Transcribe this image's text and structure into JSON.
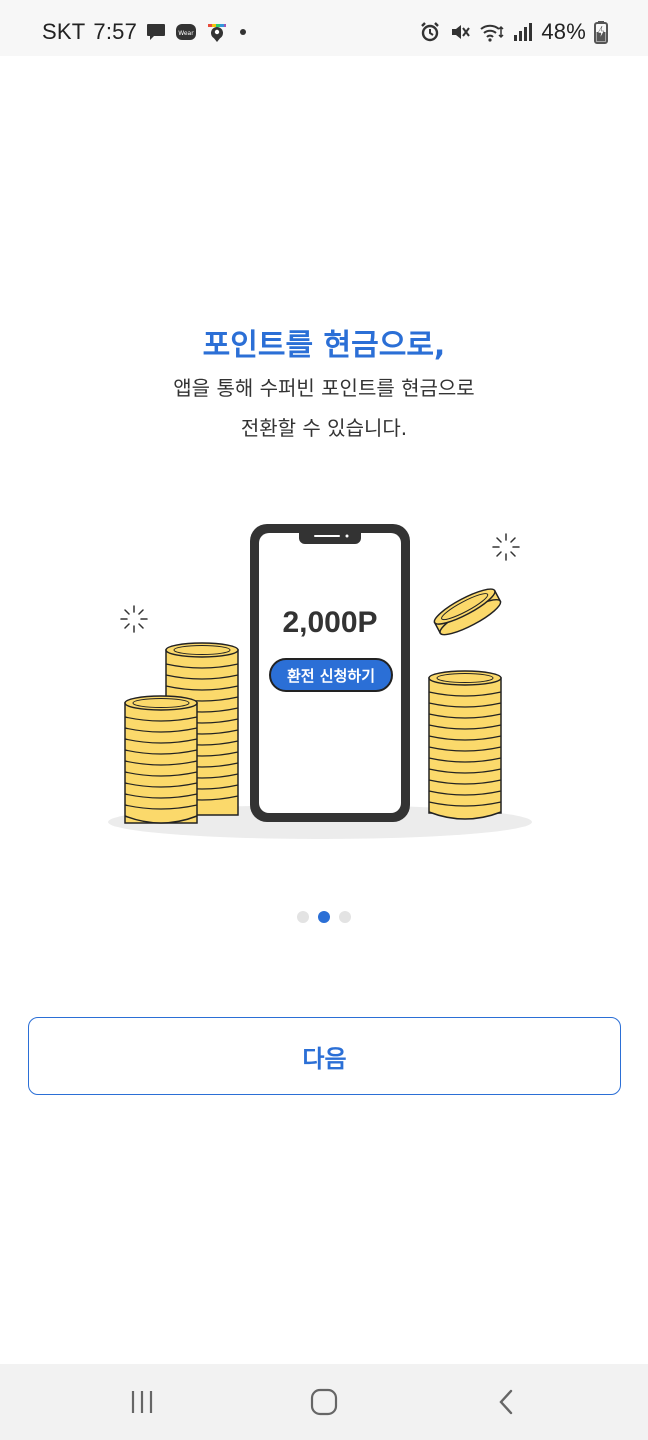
{
  "status_bar": {
    "carrier": "SKT",
    "time": "7:57",
    "battery_percent": "48%",
    "left_icons": [
      "chat-bubble-icon",
      "wear-icon",
      "map-pin-app-icon",
      "dot-icon"
    ],
    "right_icons": [
      "alarm-icon",
      "mute-icon",
      "wifi-icon",
      "signal-icon",
      "battery-charging-icon"
    ],
    "wear_label": "Wear"
  },
  "onboarding": {
    "title": "포인트를 현금으로,",
    "description_line1": "앱을 통해 수퍼빈 포인트를 현금으로",
    "description_line2": "전환할 수 있습니다.",
    "illustration": {
      "amount": "2,000P",
      "button_label": "환전 신청하기"
    },
    "pager": {
      "total": 3,
      "active_index": 1
    }
  },
  "next_button": {
    "label": "다음"
  },
  "colors": {
    "accent": "#2b6fd6",
    "coin": "#fbd96b",
    "outline": "#222222"
  },
  "nav_bar": {
    "icons": [
      "recent-apps-icon",
      "home-icon",
      "back-icon"
    ]
  }
}
